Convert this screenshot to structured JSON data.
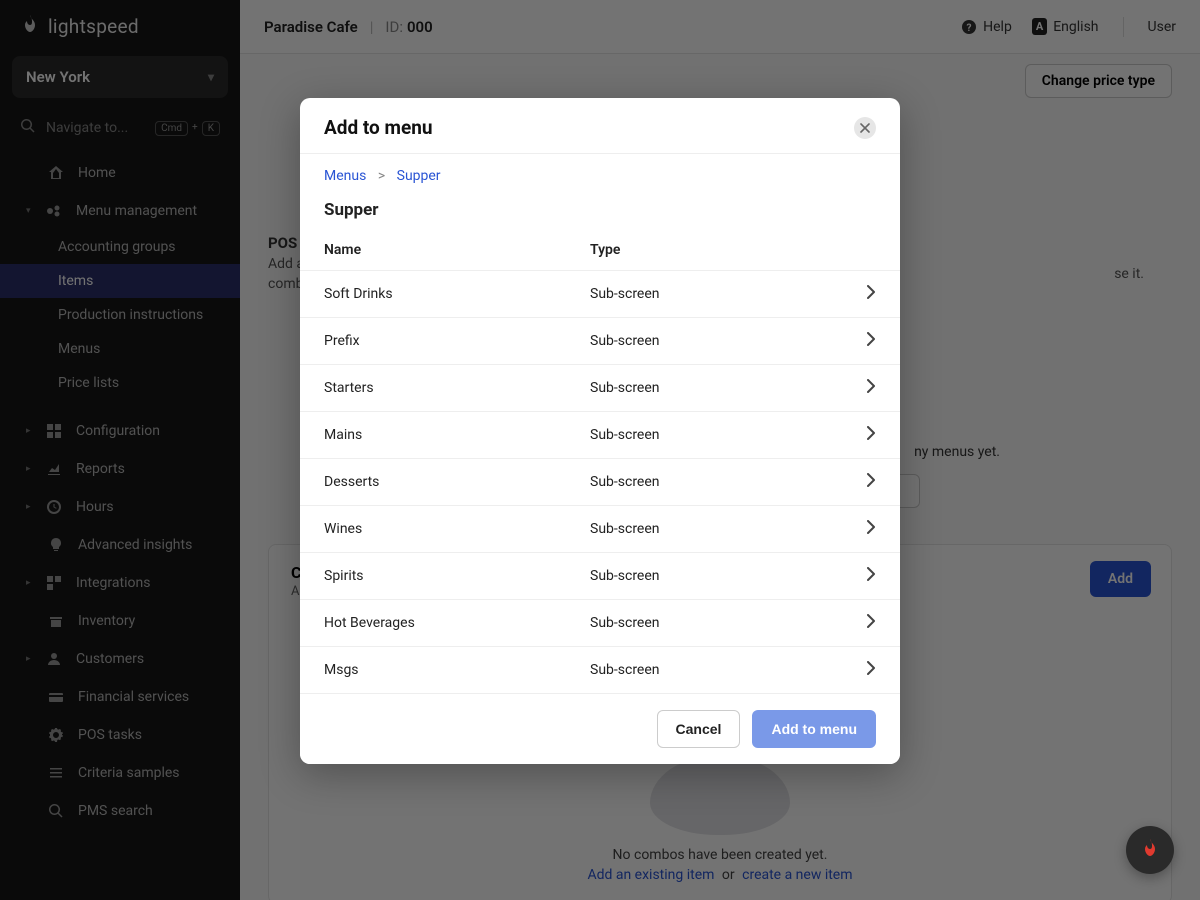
{
  "brand": "lightspeed",
  "location": "New York",
  "nav": {
    "search_placeholder": "Navigate to...",
    "kbd1": "Cmd",
    "kbd_plus": "+",
    "kbd2": "K",
    "home": "Home",
    "menu_mgmt": "Menu management",
    "menu_mgmt_children": {
      "accounting_groups": "Accounting groups",
      "items": "Items",
      "production_instructions": "Production instructions",
      "menus": "Menus",
      "price_lists": "Price lists"
    },
    "configuration": "Configuration",
    "reports": "Reports",
    "hours": "Hours",
    "advanced_insights": "Advanced insights",
    "integrations": "Integrations",
    "inventory": "Inventory",
    "customers": "Customers",
    "financial_services": "Financial services",
    "pos_tasks": "POS tasks",
    "criteria_samples": "Criteria samples",
    "pms_search": "PMS search"
  },
  "topbar": {
    "business": "Paradise Cafe",
    "id_label": "ID:",
    "id_value": "000",
    "help": "Help",
    "language": "English",
    "user": "User"
  },
  "page": {
    "pos_label": "POS M",
    "pos_desc_1": "Add an",
    "pos_desc_2": "combo",
    "change_price_btn": "Change price type",
    "se_it": "se it.",
    "no_menus_msg": "ny menus yet.",
    "combo_title": "Com",
    "combo_sub": "Add a",
    "combo_add_btn": "Add",
    "empty_combo": "No combos have been created yet.",
    "add_existing_link": "Add an existing item",
    "or_label": "or",
    "create_new_link": "create a new item"
  },
  "modal": {
    "title": "Add to menu",
    "crumb_menus": "Menus",
    "crumb_current": "Supper",
    "subtitle": "Supper",
    "col_name": "Name",
    "col_type": "Type",
    "rows": [
      {
        "name": "Soft Drinks",
        "type": "Sub-screen"
      },
      {
        "name": "Prefix",
        "type": "Sub-screen"
      },
      {
        "name": "Starters",
        "type": "Sub-screen"
      },
      {
        "name": "Mains",
        "type": "Sub-screen"
      },
      {
        "name": "Desserts",
        "type": "Sub-screen"
      },
      {
        "name": "Wines",
        "type": "Sub-screen"
      },
      {
        "name": "Spirits",
        "type": "Sub-screen"
      },
      {
        "name": "Hot Beverages",
        "type": "Sub-screen"
      },
      {
        "name": "Msgs",
        "type": "Sub-screen"
      }
    ],
    "cancel": "Cancel",
    "confirm": "Add to menu"
  }
}
